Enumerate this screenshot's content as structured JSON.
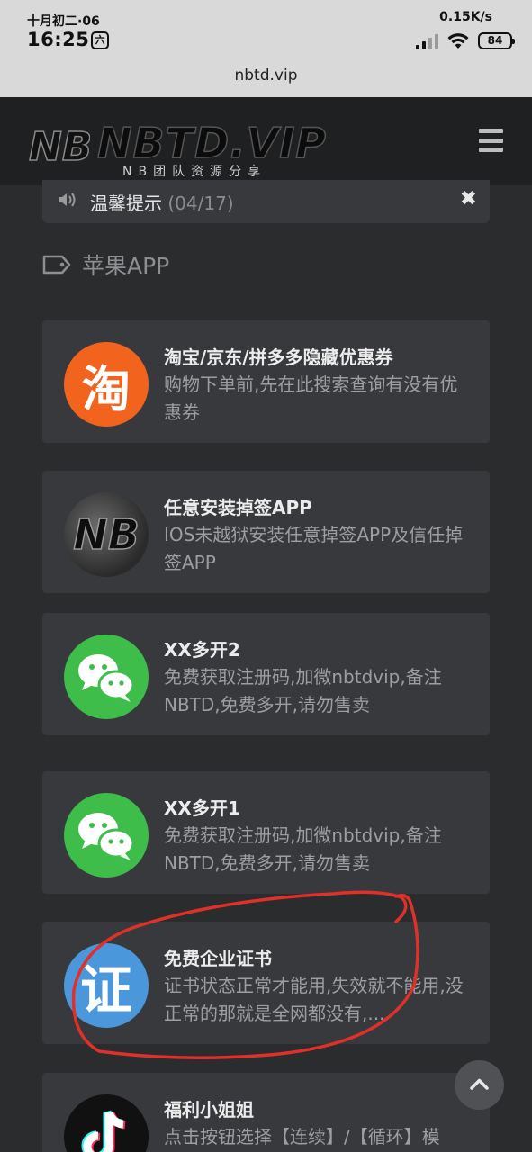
{
  "status_bar": {
    "date": "十月初二·06",
    "time": "16:25",
    "time_badge": "六",
    "net_speed": "0.15K/s",
    "battery": "84"
  },
  "browser": {
    "url": "nbtd.vip"
  },
  "header": {
    "logo_text": "NBTD.VIP",
    "logo_sub": "NB团队资源分享",
    "menu_icon": "hamburger-icon"
  },
  "notice": {
    "label": "温馨提示",
    "count": "(04/17)",
    "close": "✖"
  },
  "section": {
    "title": "苹果APP",
    "icon": "tag-icon"
  },
  "cards": [
    {
      "title": "淘宝/京东/拼多多隐藏优惠券",
      "desc": "购物下单前,先在此搜索查询有没有优惠券",
      "icon": "taobao-icon",
      "glyph": "淘",
      "color": "#f2641e"
    },
    {
      "title": "任意安装掉签APP",
      "desc": "IOS未越狱安装任意掉签APP及信任掉签APP",
      "icon": "nb-logo-icon",
      "glyph": "NB",
      "color": "#3a3a3a"
    },
    {
      "title": "XX多开2",
      "desc": "免费获取注册码,加微nbtdvip,备注NBTD,免费多开,请勿售卖",
      "icon": "wechat-icon",
      "color": "#3fbd4a"
    },
    {
      "title": "XX多开1",
      "desc": "免费获取注册码,加微nbtdvip,备注NBTD,免费多开,请勿售卖",
      "icon": "wechat-icon",
      "color": "#3fbd4a"
    },
    {
      "title": "免费企业证书",
      "desc": "证书状态正常才能用,失效就不能用,没正常的那就是全网都没有,...",
      "icon": "certificate-icon",
      "glyph": "证",
      "color": "#4a98db"
    },
    {
      "title": "福利小姐姐",
      "desc": "点击按钮选择【连续】/【循环】模",
      "icon": "tiktok-icon",
      "color": "#111111"
    }
  ],
  "scroll_top_icon": "chevron-up-icon",
  "annotation_color": "#e0302a"
}
